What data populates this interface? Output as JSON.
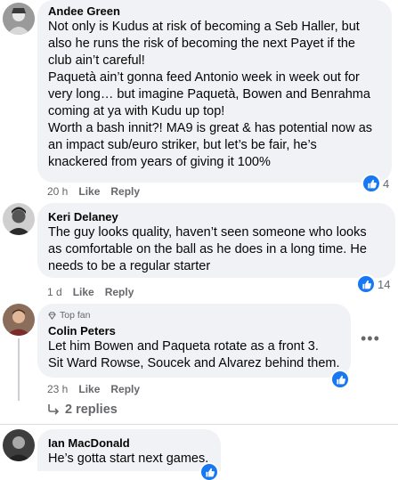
{
  "comments": [
    {
      "author": "Andee Green",
      "text": "Not only is Kudus at risk of becoming a Seb Haller, but\nalso he runs the risk of becoming the next Payet if the\nclub ain’t careful!\nPaquetà ain’t gonna feed Antonio week in week out for\nvery long… but imagine Paquetà, Bowen and Benrahma\ncoming at ya with Kudu up top!\nWorth a bash innit?! MA9 is great & has potential now as\nan impact sub/euro striker, but let’s be fair, he’s\nknackered from years of giving it 100%",
      "time": "20 h",
      "like_label": "Like",
      "reply_label": "Reply",
      "reaction_count": "4"
    },
    {
      "author": "Keri Delaney",
      "text": "The guy looks quality, haven’t seen someone who looks\nas comfortable on the ball as he does in a long time. He\nneeds to be a regular starter",
      "time": "1 d",
      "like_label": "Like",
      "reply_label": "Reply",
      "reaction_count": "14"
    },
    {
      "badge": "Top fan",
      "author": "Colin Peters",
      "text": "Let him Bowen and Paqueta rotate as a front 3.\nSit Ward Rowse, Soucek and Alvarez behind them.",
      "time": "23 h",
      "like_label": "Like",
      "reply_label": "Reply",
      "replies_label": "2 replies"
    },
    {
      "author": "Ian MacDonald",
      "text": "He’s gotta start next games."
    }
  ],
  "colors": {
    "accent": "#1877f2",
    "bubble": "#f0f2f5",
    "meta": "#65676b"
  },
  "icons": {
    "like": "thumbs-up-icon",
    "more": "more-options-icon",
    "reply_arrow": "reply-arrow-icon",
    "badge": "diamond-badge-icon"
  }
}
